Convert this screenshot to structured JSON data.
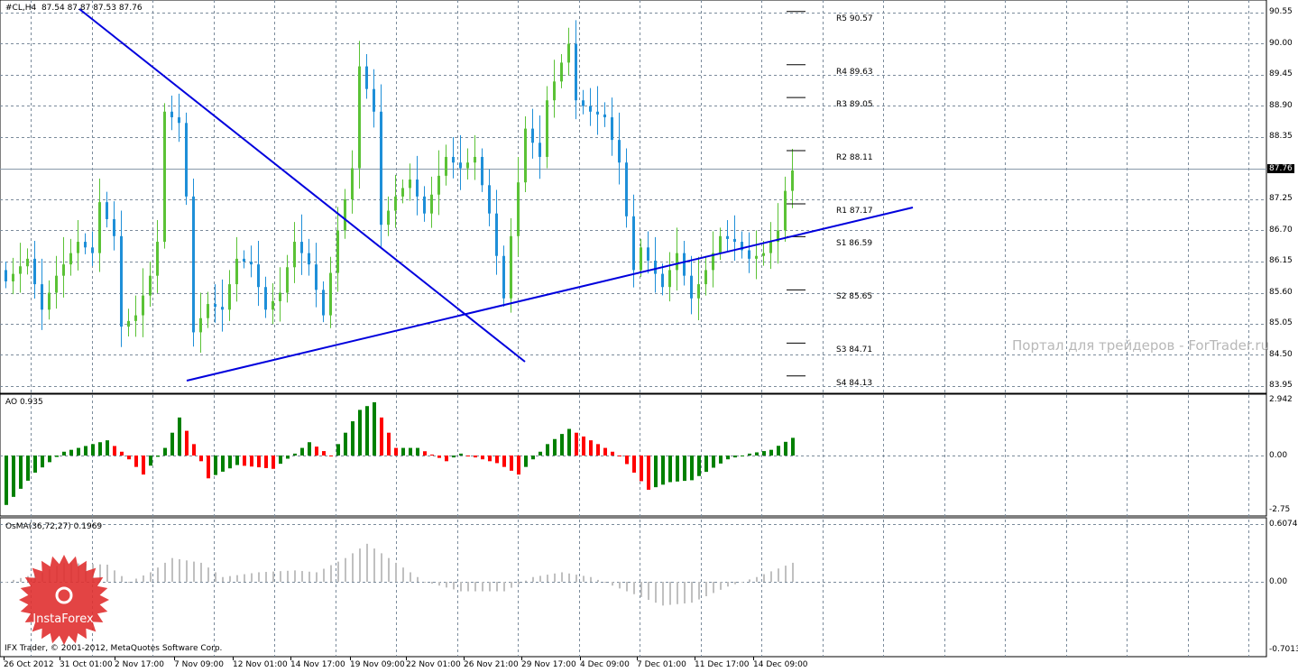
{
  "header": {
    "symbol": "#CL,H4",
    "ohlc": "87.54 87.87 87.53 87.76"
  },
  "main_axis": [
    "90.55",
    "90.00",
    "89.45",
    "88.90",
    "88.35",
    "87.25",
    "86.70",
    "86.15",
    "85.60",
    "85.05",
    "84.50",
    "83.95"
  ],
  "last_price": "87.76",
  "pivots": [
    {
      "label": "R5 90.57",
      "v": 90.57
    },
    {
      "label": "R4 89.63",
      "v": 89.63
    },
    {
      "label": "R3 89.05",
      "v": 89.05
    },
    {
      "label": "R2 88.11",
      "v": 88.11
    },
    {
      "label": "R1 87.17",
      "v": 87.17
    },
    {
      "label": "S1 86.59",
      "v": 86.59
    },
    {
      "label": "S2 85.65",
      "v": 85.65
    },
    {
      "label": "S3 84.71",
      "v": 84.71
    },
    {
      "label": "S4 84.13",
      "v": 84.13
    }
  ],
  "ao": {
    "title": "AO 0.935",
    "axis": [
      "2.942",
      "0.00",
      "-2.75"
    ]
  },
  "osma": {
    "title": "OsMA(36,72,27) 0.1969",
    "axis": [
      "0.6074",
      "0.00",
      "-0.7013"
    ]
  },
  "dates": [
    "26 Oct 2012",
    "31 Oct 01:00",
    "2 Nov 17:00",
    "7 Nov 09:00",
    "12 Nov 01:00",
    "14 Nov 17:00",
    "19 Nov 09:00",
    "22 Nov 01:00",
    "26 Nov 21:00",
    "29 Nov 17:00",
    "4 Dec 09:00",
    "7 Dec 01:00",
    "11 Dec 17:00",
    "14 Dec 09:00"
  ],
  "watermark": "Портал для трейдеров - ForTrader.ru",
  "logo": "InstaForex",
  "copyright": "IFX Trader, © 2001-2012, MetaQuotes Software Corp.",
  "colors": {
    "bull": "#5bc236",
    "bear": "#1e8fd8",
    "ao_up": "#008000",
    "ao_down": "#ff0000",
    "osma": "#c0c0c0",
    "trend": "#0000dd"
  },
  "chart_data": {
    "type": "candlestick",
    "bars": 110,
    "close_keypoints": [
      [
        0,
        85.8
      ],
      [
        3,
        86.2
      ],
      [
        5,
        85.3
      ],
      [
        7,
        85.9
      ],
      [
        10,
        86.5
      ],
      [
        12,
        86.3
      ],
      [
        13,
        87.2
      ],
      [
        15,
        86.6
      ],
      [
        16,
        85.0
      ],
      [
        18,
        85.2
      ],
      [
        20,
        85.9
      ],
      [
        21,
        86.5
      ],
      [
        22,
        88.8
      ],
      [
        24,
        88.6
      ],
      [
        25,
        87.3
      ],
      [
        26,
        84.9
      ],
      [
        28,
        85.4
      ],
      [
        30,
        85.3
      ],
      [
        32,
        86.2
      ],
      [
        34,
        86.1
      ],
      [
        36,
        85.3
      ],
      [
        38,
        85.6
      ],
      [
        40,
        86.5
      ],
      [
        42,
        86.1
      ],
      [
        44,
        85.2
      ],
      [
        46,
        86.7
      ],
      [
        48,
        87.8
      ],
      [
        49,
        89.6
      ],
      [
        51,
        88.8
      ],
      [
        52,
        86.8
      ],
      [
        54,
        87.3
      ],
      [
        56,
        87.6
      ],
      [
        58,
        87.0
      ],
      [
        61,
        88.0
      ],
      [
        63,
        87.8
      ],
      [
        65,
        88.0
      ],
      [
        67,
        87.0
      ],
      [
        69,
        85.5
      ],
      [
        70,
        86.6
      ],
      [
        72,
        88.5
      ],
      [
        74,
        88.0
      ],
      [
        75,
        89.0
      ],
      [
        78,
        90.0
      ],
      [
        79,
        89.0
      ],
      [
        81,
        88.8
      ],
      [
        83,
        88.7
      ],
      [
        85,
        87.9
      ],
      [
        87,
        86.0
      ],
      [
        88,
        86.4
      ],
      [
        91,
        85.7
      ],
      [
        93,
        86.3
      ],
      [
        95,
        85.5
      ],
      [
        97,
        86.0
      ],
      [
        99,
        86.6
      ],
      [
        101,
        86.5
      ],
      [
        103,
        86.2
      ],
      [
        105,
        86.3
      ],
      [
        107,
        86.7
      ],
      [
        108,
        87.4
      ],
      [
        109,
        87.76
      ]
    ],
    "ao_keypoints": [
      [
        0,
        -2.6
      ],
      [
        4,
        -0.9
      ],
      [
        8,
        0.2
      ],
      [
        14,
        0.8
      ],
      [
        16,
        0.2
      ],
      [
        19,
        -1.0
      ],
      [
        22,
        0.4
      ],
      [
        24,
        2.0
      ],
      [
        26,
        0.6
      ],
      [
        28,
        -1.2
      ],
      [
        32,
        -0.5
      ],
      [
        37,
        -0.7
      ],
      [
        40,
        0.1
      ],
      [
        42,
        0.7
      ],
      [
        45,
        0
      ],
      [
        49,
        2.4
      ],
      [
        51,
        2.8
      ],
      [
        54,
        0.4
      ],
      [
        57,
        0.4
      ],
      [
        61,
        -0.3
      ],
      [
        63,
        0.1
      ],
      [
        68,
        -0.4
      ],
      [
        71,
        -1.0
      ],
      [
        75,
        0.6
      ],
      [
        78,
        1.4
      ],
      [
        82,
        0.6
      ],
      [
        85,
        0
      ],
      [
        89,
        -1.8
      ],
      [
        92,
        -1.4
      ],
      [
        95,
        -1.3
      ],
      [
        100,
        -0.2
      ],
      [
        103,
        0.1
      ],
      [
        106,
        0.3
      ],
      [
        109,
        0.93
      ]
    ],
    "osma_keypoints": [
      [
        0,
        0.0
      ],
      [
        5,
        0.1
      ],
      [
        8,
        0.2
      ],
      [
        14,
        0.18
      ],
      [
        17,
        0.0
      ],
      [
        20,
        0.1
      ],
      [
        23,
        0.25
      ],
      [
        27,
        0.2
      ],
      [
        30,
        0.05
      ],
      [
        35,
        0.1
      ],
      [
        40,
        0.12
      ],
      [
        43,
        0.1
      ],
      [
        47,
        0.25
      ],
      [
        50,
        0.4
      ],
      [
        53,
        0.25
      ],
      [
        58,
        0.0
      ],
      [
        63,
        -0.1
      ],
      [
        69,
        -0.1
      ],
      [
        73,
        0.05
      ],
      [
        77,
        0.1
      ],
      [
        81,
        0.05
      ],
      [
        86,
        -0.1
      ],
      [
        91,
        -0.25
      ],
      [
        95,
        -0.22
      ],
      [
        100,
        -0.05
      ],
      [
        104,
        0.05
      ],
      [
        109,
        0.2
      ]
    ],
    "main_range": [
      83.95,
      90.55
    ],
    "ao_range": [
      -2.75,
      2.942
    ],
    "osma_range": [
      -0.7013,
      0.6074
    ]
  }
}
